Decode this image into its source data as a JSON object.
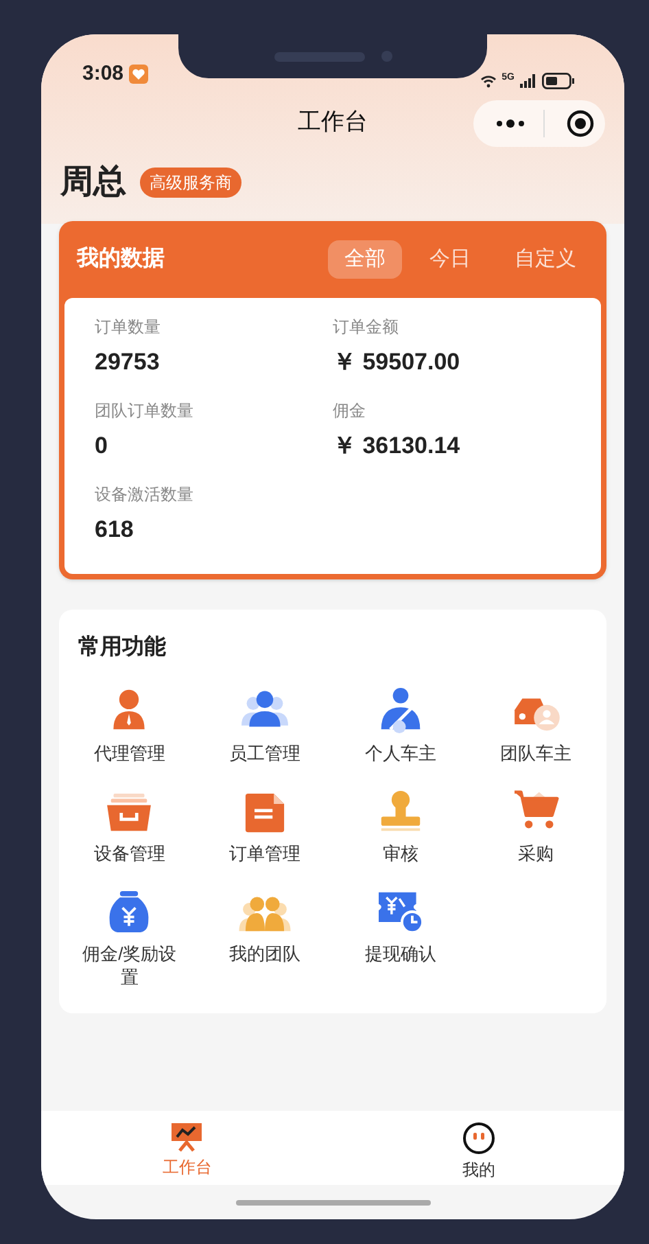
{
  "status_bar": {
    "time": "3:08",
    "network": "5G"
  },
  "nav": {
    "title": "工作台"
  },
  "user": {
    "name": "周总",
    "badge": "高级服务商"
  },
  "my_data": {
    "title": "我的数据",
    "tabs": [
      {
        "label": "全部",
        "selected": true
      },
      {
        "label": "今日",
        "selected": false
      },
      {
        "label": "自定义",
        "selected": false
      }
    ],
    "stats": [
      {
        "label": "订单数量",
        "value": "29753"
      },
      {
        "label": "订单金额",
        "value": "￥ 59507.00"
      },
      {
        "label": "团队订单数量",
        "value": "0"
      },
      {
        "label": "佣金",
        "value": "￥ 36130.14"
      },
      {
        "label": "设备激活数量",
        "value": "618"
      }
    ]
  },
  "functions": {
    "title": "常用功能",
    "items": [
      {
        "label": "代理管理"
      },
      {
        "label": "员工管理"
      },
      {
        "label": "个人车主"
      },
      {
        "label": "团队车主"
      },
      {
        "label": "设备管理"
      },
      {
        "label": "订单管理"
      },
      {
        "label": "审核"
      },
      {
        "label": "采购"
      },
      {
        "label": "佣金/奖励设置"
      },
      {
        "label": "我的团队"
      },
      {
        "label": "提现确认"
      }
    ]
  },
  "tab_bar": [
    {
      "label": "工作台",
      "selected": true
    },
    {
      "label": "我的",
      "selected": false
    }
  ]
}
